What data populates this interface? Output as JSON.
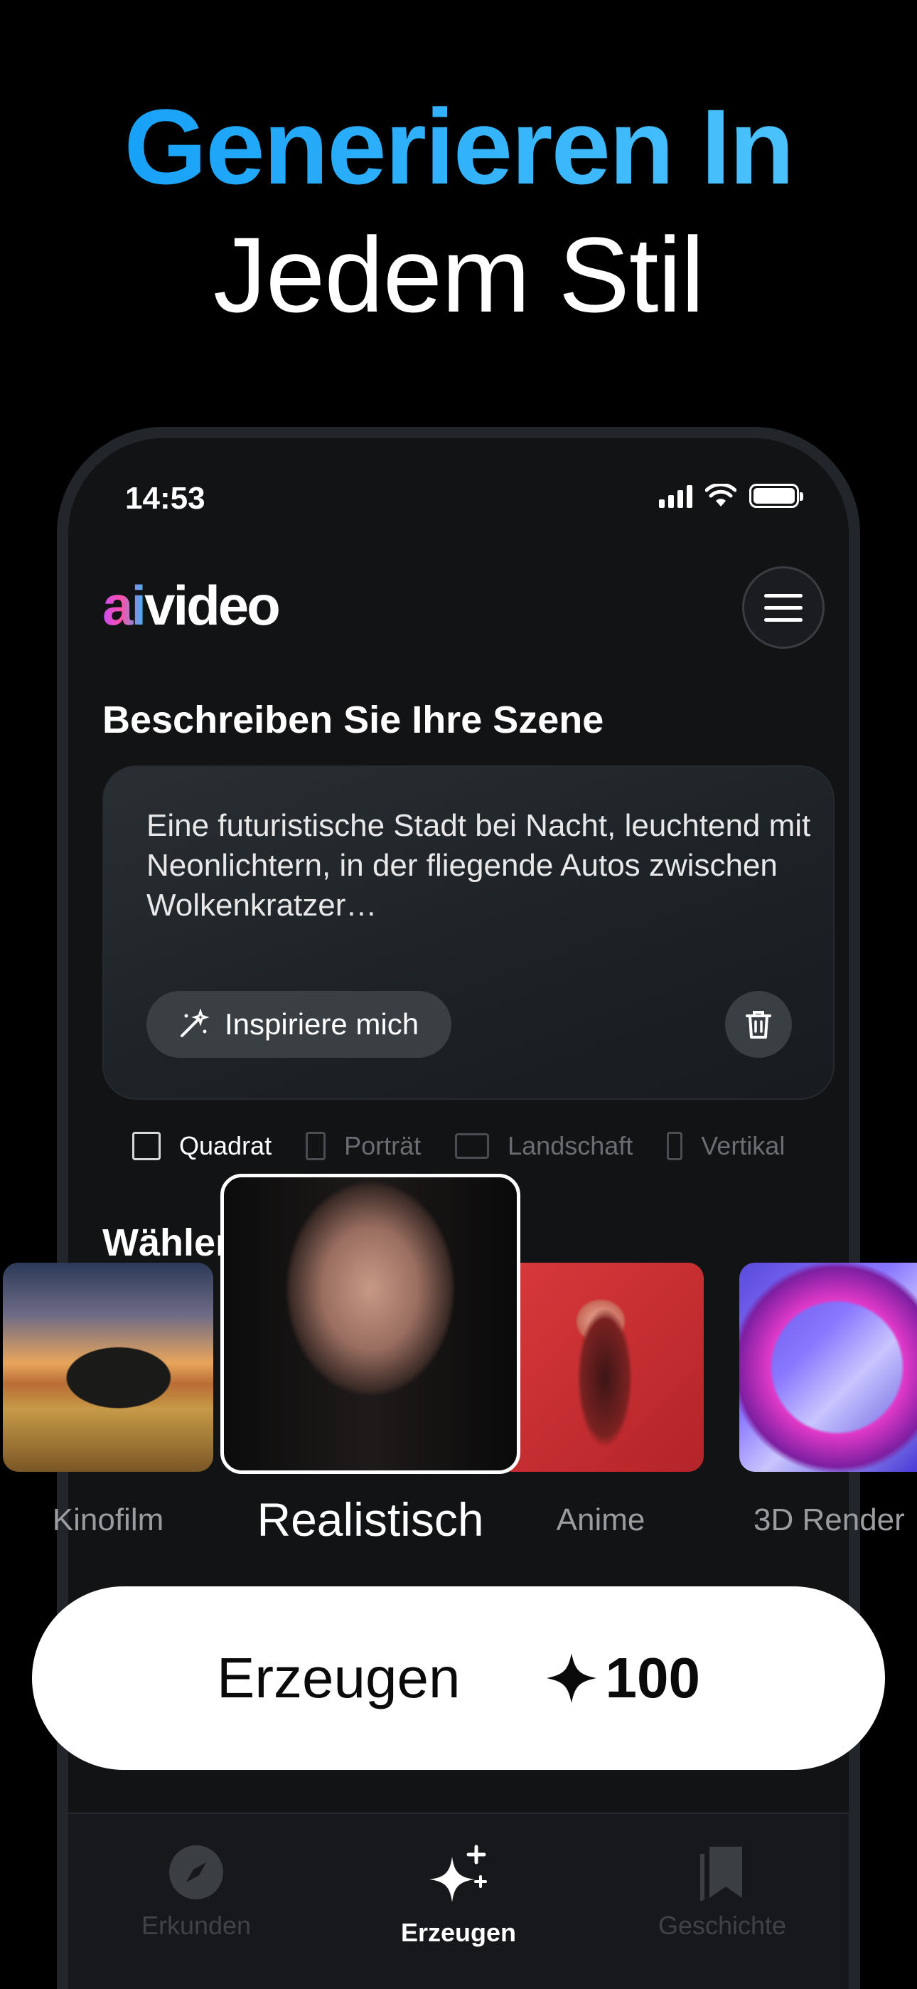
{
  "headline": {
    "line1": "Generieren In",
    "line2": "Jedem Stil"
  },
  "status_bar": {
    "time": "14:53"
  },
  "app": {
    "logo_ai": "ai",
    "logo_video": "video"
  },
  "scene": {
    "title": "Beschreiben Sie Ihre Szene",
    "prompt": "Eine futuristische Stadt bei Nacht, leuchtend mit Neonlichtern, in der fliegende Autos zwischen Wolkenkratzer…",
    "inspire_label": "Inspiriere mich"
  },
  "aspect_ratios": [
    {
      "label": "Quadrat",
      "selected": true
    },
    {
      "label": "Porträt",
      "selected": false
    },
    {
      "label": "Landschaft",
      "selected": false
    },
    {
      "label": "Vertikal",
      "selected": false
    }
  ],
  "styles": {
    "title": "Wählen",
    "items": [
      {
        "label": "Kinofilm",
        "selected": false
      },
      {
        "label": "Realistisch",
        "selected": true
      },
      {
        "label": "Anime",
        "selected": false
      },
      {
        "label": "3D Render",
        "selected": false
      }
    ]
  },
  "generate": {
    "label": "Erzeugen",
    "credits": "100"
  },
  "tabs": [
    {
      "label": "Erkunden",
      "icon": "compass-icon",
      "active": false
    },
    {
      "label": "Erzeugen",
      "icon": "sparkles-icon",
      "active": true
    },
    {
      "label": "Geschichte",
      "icon": "bookmarks-icon",
      "active": false
    }
  ],
  "colors": {
    "accent": "#1ea7fd",
    "background": "#000000",
    "card": "#1d2226",
    "frame_accent": "#1e8fe0"
  }
}
